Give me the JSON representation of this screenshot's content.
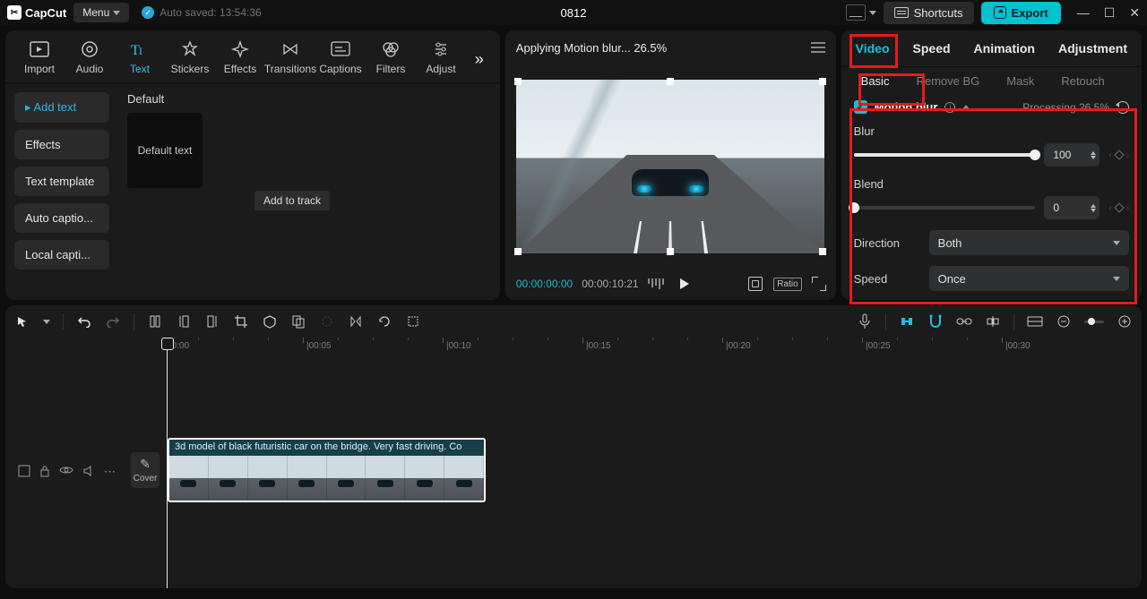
{
  "app": {
    "name": "CapCut",
    "menu": "Menu",
    "autosave": "Auto saved: 13:54:36",
    "project": "0812"
  },
  "titlebar": {
    "shortcuts": "Shortcuts",
    "export": "Export"
  },
  "tool_tabs": [
    "Import",
    "Audio",
    "Text",
    "Stickers",
    "Effects",
    "Transitions",
    "Captions",
    "Filters",
    "Adjust"
  ],
  "left_sidebar": {
    "items": [
      "Add text",
      "Effects",
      "Text template",
      "Auto captio...",
      "Local capti..."
    ]
  },
  "left_content": {
    "heading": "Default",
    "thumb_label": "Default text",
    "tooltip": "Add to track"
  },
  "preview": {
    "title": "Applying Motion blur... 26.5%",
    "timecode_current": "00:00:00:00",
    "timecode_duration": "00:00:10:21",
    "ratio_label": "Ratio"
  },
  "right": {
    "tabs": [
      "Video",
      "Speed",
      "Animation",
      "Adjustment"
    ],
    "subtabs": [
      "Basic",
      "Remove BG",
      "Mask",
      "Retouch"
    ],
    "section": {
      "title": "Motion blur",
      "processing": "Processing 26.5%",
      "blur_label": "Blur",
      "blur_value": "100",
      "blend_label": "Blend",
      "blend_value": "0",
      "direction_label": "Direction",
      "direction_value": "Both",
      "speed_label": "Speed",
      "speed_value": "Once"
    }
  },
  "timeline": {
    "ruler": [
      "00:00",
      "|00:05",
      "|00:10",
      "|00:15",
      "|00:20",
      "|00:25",
      "|00:30"
    ],
    "cover": "Cover",
    "clip_label": "3d model of black futuristic car on the bridge. Very fast driving. Co"
  }
}
